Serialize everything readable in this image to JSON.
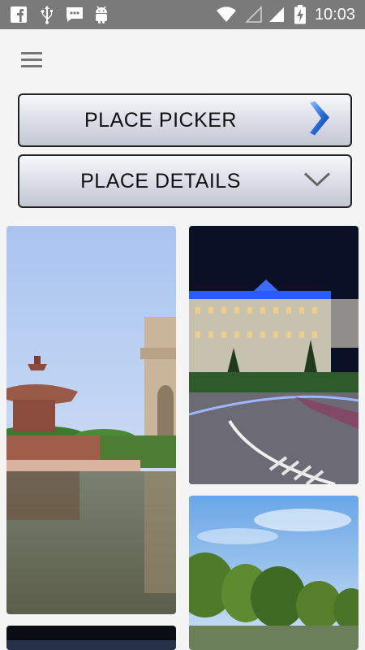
{
  "status_bar": {
    "time": "10:03",
    "left_icons": [
      "facebook-icon",
      "usb-icon",
      "message-icon",
      "android-icon"
    ],
    "right_icons": [
      "wifi-icon",
      "signal-empty-icon",
      "signal-icon",
      "battery-charging-icon"
    ]
  },
  "menu": {
    "icon": "hamburger-menu-icon"
  },
  "buttons": {
    "place_picker": {
      "label": "PLACE PICKER",
      "icon": "chevron-right-icon"
    },
    "place_details": {
      "label": "PLACE DETAILS",
      "icon": "chevron-down-icon"
    }
  },
  "gallery": {
    "images": [
      {
        "name": "india-gate-fountain-image"
      },
      {
        "name": "city-building-night-image"
      },
      {
        "name": "lake-trees-image"
      },
      {
        "name": "dark-image"
      }
    ]
  },
  "colors": {
    "status_bar": "#7a7a7a",
    "background": "#f4f4f4",
    "chevron_blue": "#1f5fd6"
  }
}
